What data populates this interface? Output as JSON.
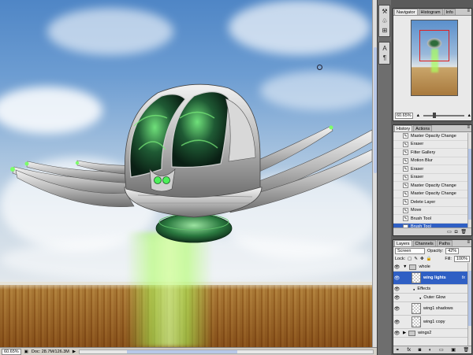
{
  "status_bar": {
    "zoom": "60.65%",
    "doc_info": "Doc: 28.7M/126.3M"
  },
  "navigator": {
    "tabs": [
      "Navigator",
      "Histogram",
      "Info"
    ],
    "zoom": "60.65%"
  },
  "history": {
    "tabs": [
      "History",
      "Actions"
    ],
    "items": [
      "Master Opacity Change",
      "Eraser",
      "Filter Gallery",
      "Motion Blur",
      "Eraser",
      "Eraser",
      "Master Opacity Change",
      "Master Opacity Change",
      "Delete Layer",
      "Move",
      "Brush Tool",
      "Brush Tool"
    ],
    "active_index": 11
  },
  "layers": {
    "tabs": [
      "Layers",
      "Channels",
      "Paths"
    ],
    "blend_mode": "Screen",
    "opacity_label": "Opacity:",
    "opacity": "42%",
    "lock_label": "Lock:",
    "fill_label": "Fill:",
    "fill": "100%",
    "rows": [
      {
        "name": "whole",
        "kind": "group"
      },
      {
        "name": "wing lights",
        "kind": "layer",
        "active": true,
        "fx": "fx"
      },
      {
        "name": "Effects",
        "kind": "effects"
      },
      {
        "name": "Outer Glow",
        "kind": "effect"
      },
      {
        "name": "wing1 shadows",
        "kind": "layer"
      },
      {
        "name": "wing1 copy",
        "kind": "layer"
      },
      {
        "name": "wings2",
        "kind": "group"
      }
    ]
  },
  "colors": {
    "selection_blue": "#2f5fc4",
    "panel_bg": "#e9e9e9",
    "beam_green": "#aaff5a"
  },
  "tool_icons": [
    "arrange-icon",
    "clone-icon",
    "puppet-icon",
    "type-icon",
    "paragraph-icon"
  ]
}
